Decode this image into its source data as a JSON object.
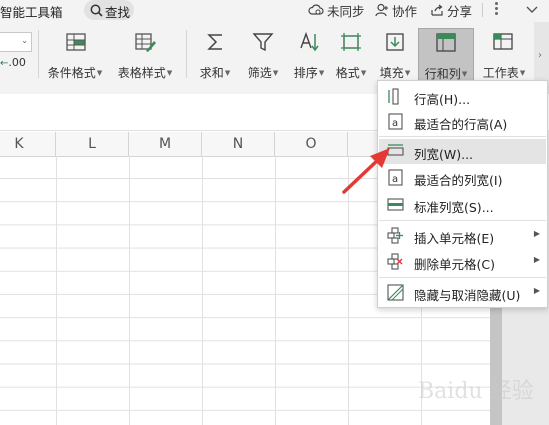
{
  "titlebar": {
    "app_title": "智能工具箱",
    "search_label": "查找",
    "sync_label": "未同步",
    "collab_label": "协作",
    "share_label": "分享"
  },
  "ribbon": {
    "buttons": [
      {
        "label": "条件格式",
        "icon": "conditional-format-icon"
      },
      {
        "label": "表格样式",
        "icon": "table-style-icon"
      },
      {
        "label": "求和",
        "icon": "sum-icon"
      },
      {
        "label": "筛选",
        "icon": "filter-icon"
      },
      {
        "label": "排序",
        "icon": "sort-icon"
      },
      {
        "label": "格式",
        "icon": "format-icon"
      },
      {
        "label": "填充",
        "icon": "fill-icon"
      },
      {
        "label": "行和列",
        "icon": "rows-columns-icon"
      },
      {
        "label": "工作表",
        "icon": "worksheet-icon"
      }
    ],
    "decimal_label": ".00"
  },
  "sheet": {
    "columns": [
      "K",
      "L",
      "M",
      "N",
      "O"
    ]
  },
  "menu": {
    "items": [
      {
        "label": "行高(H)...",
        "icon": "row-height-icon",
        "submenu": false
      },
      {
        "label": "最适合的行高(A)",
        "icon": "autofit-row-icon",
        "submenu": false
      },
      {
        "label": "列宽(W)...",
        "icon": "column-width-icon",
        "submenu": false,
        "highlighted": true
      },
      {
        "label": "最适合的列宽(I)",
        "icon": "autofit-column-icon",
        "submenu": false
      },
      {
        "label": "标准列宽(S)...",
        "icon": "standard-width-icon",
        "submenu": false
      },
      {
        "label": "插入单元格(E)",
        "icon": "insert-cell-icon",
        "submenu": true
      },
      {
        "label": "删除单元格(C)",
        "icon": "delete-cell-icon",
        "submenu": true
      },
      {
        "label": "隐藏与取消隐藏(U)",
        "icon": "hide-unhide-icon",
        "submenu": true
      }
    ]
  },
  "colors": {
    "accent_green": "#3c8a5a",
    "arrow_red": "#e53935"
  },
  "watermark": "Baidu 经验"
}
